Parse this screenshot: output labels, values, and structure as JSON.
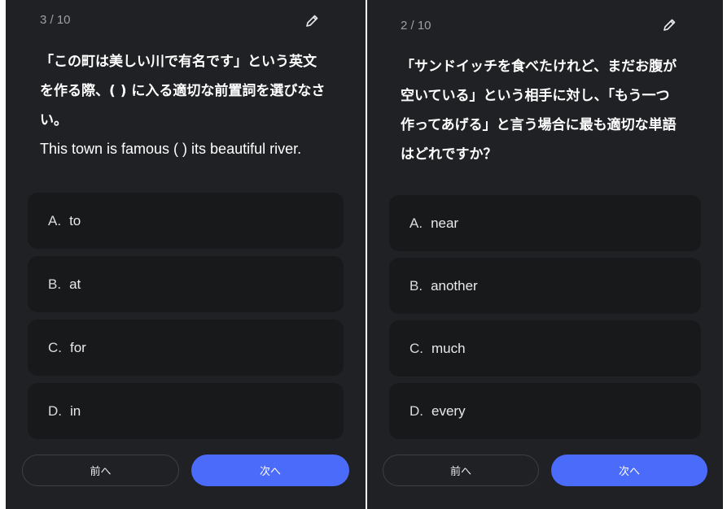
{
  "colors": {
    "panel_bg": "#202124",
    "option_bg": "#18191b",
    "accent": "#4b6bfb",
    "muted": "#9aa0a6"
  },
  "panels": [
    {
      "counter": "3 / 10",
      "edit_icon": "pencil-icon",
      "question": "「この町は美しい川で有名です」という英文\nを作る際、( ) に入る適切な前置詞を選びなさ\nい。",
      "question_en": "This town is famous ( ) its beautiful river.",
      "options": [
        {
          "letter": "A.",
          "text": "to"
        },
        {
          "letter": "B.",
          "text": "at"
        },
        {
          "letter": "C.",
          "text": "for"
        },
        {
          "letter": "D.",
          "text": "in"
        }
      ],
      "prev_label": "前へ",
      "next_label": "次へ"
    },
    {
      "counter": "2 / 10",
      "edit_icon": "pencil-icon",
      "question": "「サンドイッチを食べたけれど、まだお腹が\n空いている」という相手に対し、「もう一つ\n作ってあげる」と言う場合に最も適切な単語\nはどれですか？",
      "question_en": "",
      "options": [
        {
          "letter": "A.",
          "text": "near"
        },
        {
          "letter": "B.",
          "text": "another"
        },
        {
          "letter": "C.",
          "text": "much"
        },
        {
          "letter": "D.",
          "text": "every"
        }
      ],
      "prev_label": "前へ",
      "next_label": "次へ"
    }
  ]
}
